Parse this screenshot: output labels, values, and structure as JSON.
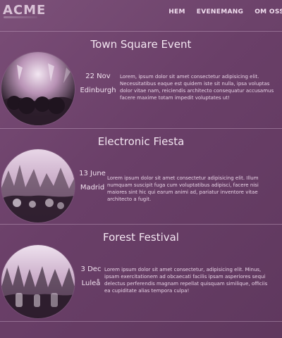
{
  "brand": {
    "logo": "ACME"
  },
  "nav": {
    "items": [
      {
        "label": "HEM"
      },
      {
        "label": "EVENEMANG"
      },
      {
        "label": "OM OSS"
      }
    ]
  },
  "events": [
    {
      "title": "Town Square Event",
      "date": "22 Nov",
      "city": "Edinburgh",
      "description": "Lorem, ipsum dolor sit amet consectetur adipisicing elit. Necessitatibus eaque est quidem iste sit nulla, ipsa voluptas dolor vitae nam, reiciendis architecto consequatur accusamus facere maxime totam impedit voluptates ut!"
    },
    {
      "title": "Electronic Fiesta",
      "date": "13 June",
      "city": "Madrid",
      "description": "Lorem ipsum dolor sit amet consectetur adipisicing elit. Illum numquam suscipit fuga cum voluptatibus adipisci, facere nisi maiores sint hic qui earum animi ad, pariatur inventore vitae architecto a fugit."
    },
    {
      "title": "Forest Festival",
      "date": "3 Dec",
      "city": "Luleå",
      "description": "Lorem ipsum dolor sit amet consectetur, adipisicing elit. Minus, ipsam exercitationem ad obcaecati facilis ipsam asperiores sequi delectus perferendis magnam repellat quisquam similique, officiis ea cupiditate alias tempora culpa!"
    }
  ]
}
